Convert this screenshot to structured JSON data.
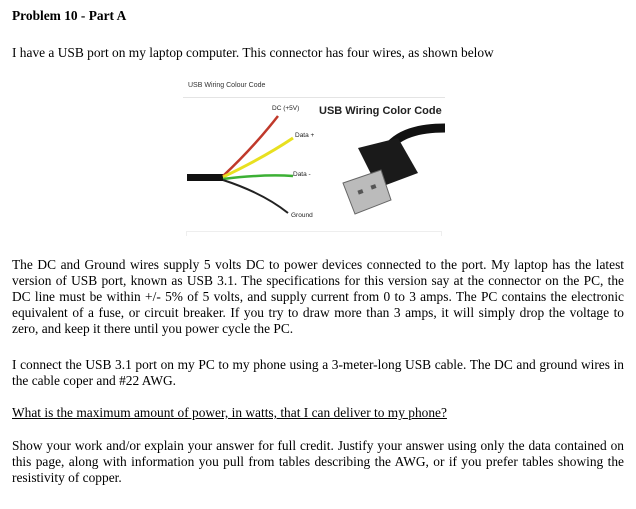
{
  "title": "Problem 10 - Part A",
  "intro": "I have a USB port on my laptop computer.  This connector has four wires, as shown below",
  "figure": {
    "caption": "USB Wiring Colour Code",
    "heading": "USB Wiring Color Code",
    "wires": [
      {
        "label": "DC (+5V)",
        "color": "#c0392b"
      },
      {
        "label": "Data +",
        "color": "#e8e020"
      },
      {
        "label": "Data -",
        "color": "#3cb034"
      },
      {
        "label": "Ground",
        "color": "#222222"
      }
    ]
  },
  "paragraph1": "The DC and Ground wires supply 5 volts DC to power devices connected to the port.  My laptop has the latest version of USB port, known as USB 3.1.  The specifications for this version say at the connector on the PC, the DC line must be within +/- 5% of 5 volts, and supply current from 0 to 3 amps.  The PC contains the electronic equivalent of a fuse, or circuit breaker.  If you try to draw more than 3 amps, it will simply drop the voltage to zero, and keep it there until you power cycle the PC.",
  "paragraph2": "I connect the USB 3.1 port on my PC to my phone using a 3-meter-long USB cable.  The DC and ground wires in the cable coper and #22 AWG.",
  "question": "What is the maximum amount of power, in watts, that I can deliver to my phone?",
  "paragraph3": "Show your work and/or explain your answer for full credit.  Justify your answer using only the data contained on this page, along with information you pull from tables describing the AWG, or if you prefer tables showing the resistivity of copper."
}
